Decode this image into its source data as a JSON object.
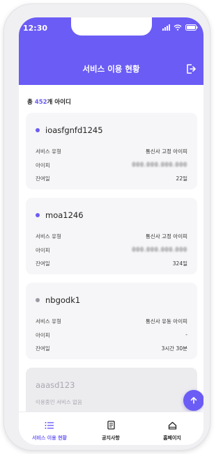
{
  "status": {
    "time": "12:30"
  },
  "header": {
    "title": "서비스 이용 현황"
  },
  "summary": {
    "prefix": "총 ",
    "count": "452",
    "suffix": "개 아이디"
  },
  "cards": [
    {
      "id": "ioasfgnfd1245",
      "active": true,
      "rows": [
        {
          "label": "서비스 유형",
          "value": "통신사 고정 아이피"
        },
        {
          "label": "아이피",
          "value": "000.000.000.000"
        },
        {
          "label": "잔여일",
          "value": "22일"
        }
      ]
    },
    {
      "id": "moa1246",
      "active": true,
      "rows": [
        {
          "label": "서비스 유형",
          "value": "통신사 고정 아이피"
        },
        {
          "label": "아이피",
          "value": "000.000.000.000"
        },
        {
          "label": "잔여일",
          "value": "324일"
        }
      ]
    },
    {
      "id": "nbgodk1",
      "active": false,
      "rows": [
        {
          "label": "서비스 유형",
          "value": "통신사 유동 아이피"
        },
        {
          "label": "아이피",
          "value": "-"
        },
        {
          "label": "잔여일",
          "value": "3시간 30분"
        }
      ]
    },
    {
      "id": "aaasd123",
      "note": "이용중인 서비스 없음"
    }
  ],
  "tabs": [
    {
      "label": "서비스 이용 현황",
      "icon": "list-icon",
      "active": true
    },
    {
      "label": "공지사항",
      "icon": "document-icon",
      "active": false
    },
    {
      "label": "홈페이지",
      "icon": "home-icon",
      "active": false
    }
  ],
  "colors": {
    "accent": "#6b5cf5",
    "inactive_dot": "#9a9aa4"
  }
}
